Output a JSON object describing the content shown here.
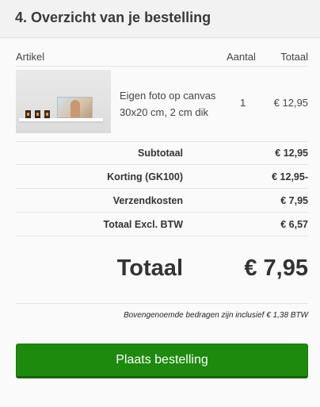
{
  "section": {
    "title": "4. Overzicht van je bestelling"
  },
  "table": {
    "headers": {
      "article": "Artikel",
      "quantity": "Aantal",
      "total": "Totaal"
    },
    "items": [
      {
        "name_line1": "Eigen foto op canvas",
        "name_line2": "30x20 cm, 2 cm dik",
        "quantity": "1",
        "total": "€ 12,95",
        "image": "canvas-product-photo"
      }
    ]
  },
  "summary": [
    {
      "label": "Subtotaal",
      "value": "€ 12,95"
    },
    {
      "label": "Korting (GK100)",
      "value": "€ 12,95-"
    },
    {
      "label": "Verzendkosten",
      "value": "€ 7,95"
    },
    {
      "label": "Totaal Excl. BTW",
      "value": "€ 6,57"
    }
  ],
  "grand_total": {
    "label": "Totaal",
    "value": "€ 7,95"
  },
  "vat_note": "Bovengenoemde bedragen zijn inclusief € 1,38 BTW",
  "cta": {
    "label": "Plaats bestelling",
    "color": "#1d8a0e"
  }
}
